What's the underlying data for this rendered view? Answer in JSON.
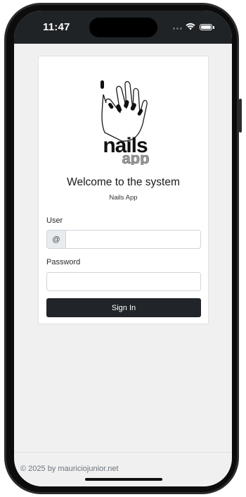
{
  "status_bar": {
    "time": "11:47"
  },
  "logo": {
    "brand_main": "nails",
    "brand_sub": "app"
  },
  "login": {
    "welcome": "Welcome to the system",
    "subtitle": "Nails App",
    "user_label": "User",
    "user_addon": "@",
    "user_value": "",
    "password_label": "Password",
    "password_value": "",
    "signin_label": "Sign In"
  },
  "footer": {
    "text": "© 2025 by mauriciojunior.net"
  },
  "colors": {
    "status_bar_bg": "#1f2326",
    "page_bg": "#f0f0f0",
    "button_bg": "#212529"
  }
}
